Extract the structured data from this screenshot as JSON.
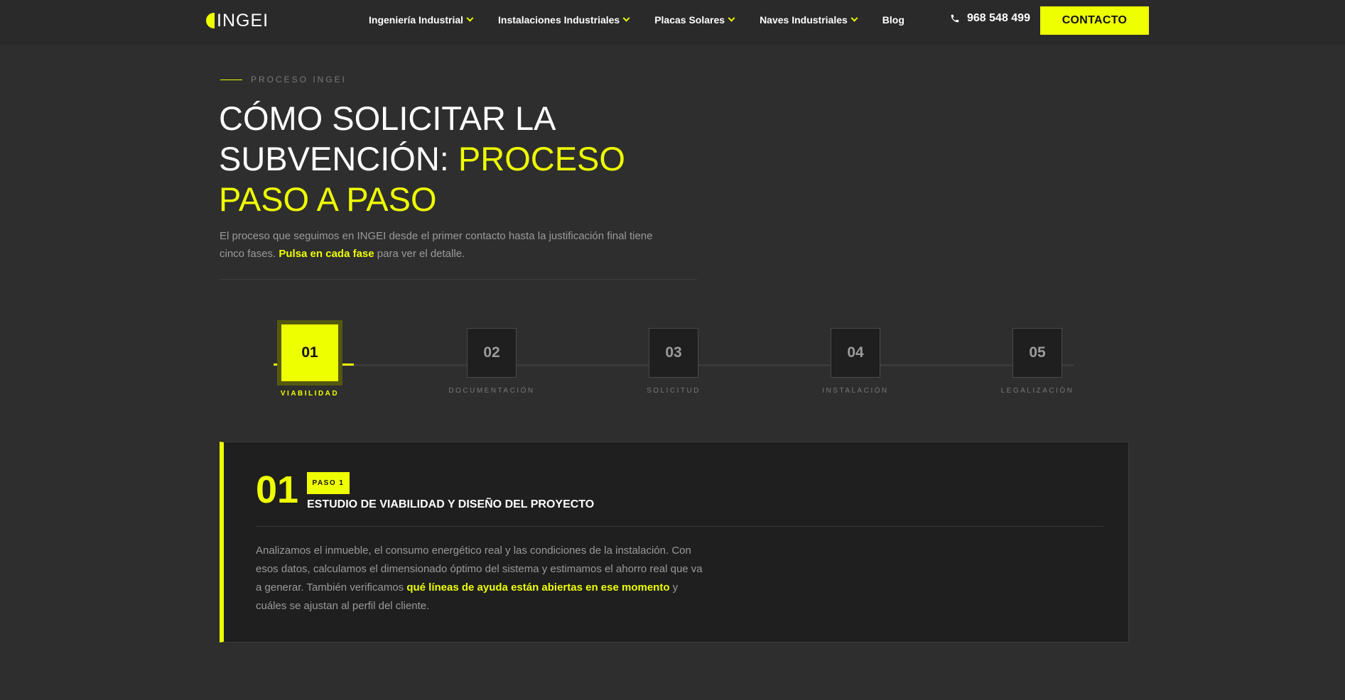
{
  "brand": {
    "logo_text": "INGEI",
    "accent_color": "#eeff00",
    "background": "#2e2e2e"
  },
  "nav": {
    "items": [
      {
        "label": "Ingeniería Industrial",
        "has_dropdown": true
      },
      {
        "label": "Instalaciones Industriales",
        "has_dropdown": true
      },
      {
        "label": "Placas Solares",
        "has_dropdown": true
      },
      {
        "label": "Naves Industriales",
        "has_dropdown": true
      },
      {
        "label": "Blog",
        "has_dropdown": false
      }
    ],
    "phone": "968 548 499",
    "phone_icon": "phone-icon",
    "cta_label": "CONTACTO"
  },
  "section": {
    "eyebrow": "PROCESO INGEI",
    "title_white": "CÓMO SOLICITAR LA SUBVENCIÓN: ",
    "title_accent": "PROCESO PASO A PASO",
    "lead_pre": "El proceso que seguimos en INGEI desde el primer contacto hasta la justificación final tiene cinco fases. ",
    "lead_bold": "Pulsa en cada fase",
    "lead_post": " para ver el detalle."
  },
  "steps": [
    {
      "number": "01",
      "label": "VIABILIDAD",
      "active": true
    },
    {
      "number": "02",
      "label": "DOCUMENTACIÓN",
      "active": false
    },
    {
      "number": "03",
      "label": "SOLICITUD",
      "active": false
    },
    {
      "number": "04",
      "label": "INSTALACIÓN",
      "active": false
    },
    {
      "number": "05",
      "label": "LEGALIZACIÓN",
      "active": false
    }
  ],
  "detail": {
    "number": "01",
    "badge": "PASO 1",
    "title": "ESTUDIO DE VIABILIDAD Y DISEÑO DEL PROYECTO",
    "text_pre": "Analizamos el inmueble, el consumo energético real y las condiciones de la instalación. Con esos datos, calculamos el dimensionado óptimo del sistema y estimamos el ahorro real que va a generar. También verificamos ",
    "text_bold": "qué líneas de ayuda están abiertas en ese momento",
    "text_post": " y cuáles se ajustan al perfil del cliente."
  }
}
